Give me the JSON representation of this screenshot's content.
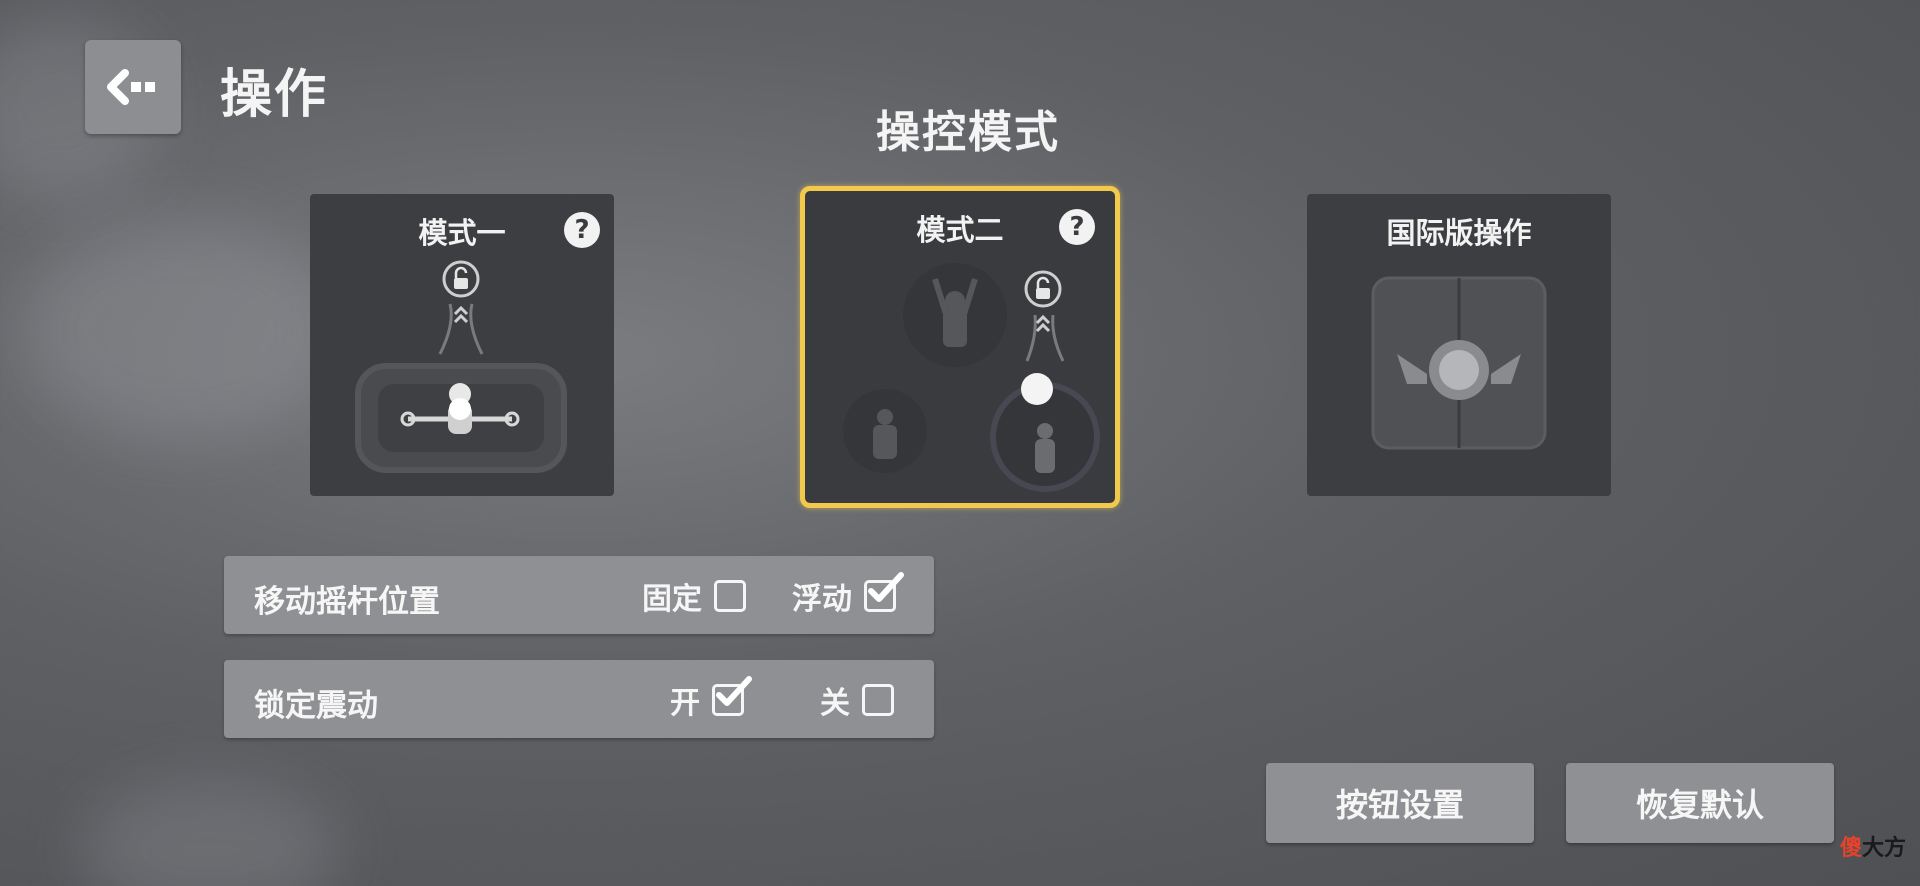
{
  "header": {
    "title": "操作",
    "back_icon": "back-arrow-icon"
  },
  "section": {
    "title": "操控模式"
  },
  "modes": [
    {
      "label": "模式一",
      "selected": false,
      "has_help": true
    },
    {
      "label": "模式二",
      "selected": true,
      "has_help": true
    },
    {
      "label": "国际版操作",
      "selected": false,
      "has_help": false
    }
  ],
  "help_icon_glyph": "?",
  "settings": {
    "joystick": {
      "label": "移动摇杆位置",
      "options": [
        {
          "label": "固定",
          "checked": false
        },
        {
          "label": "浮动",
          "checked": true
        }
      ]
    },
    "vibration": {
      "label": "锁定震动",
      "options": [
        {
          "label": "开",
          "checked": true
        },
        {
          "label": "关",
          "checked": false
        }
      ]
    }
  },
  "buttons": {
    "button_settings": "按钮设置",
    "restore_default": "恢复默认"
  },
  "watermark": {
    "char1": "傻",
    "char2": "大方"
  },
  "colors": {
    "selected_border": "#f2c94c",
    "panel": "#8f9093",
    "card": "#3d3e41"
  }
}
